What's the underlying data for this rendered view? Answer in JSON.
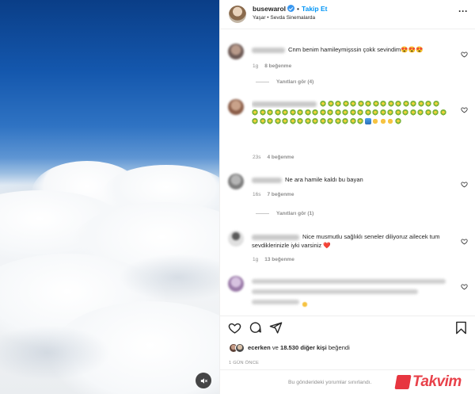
{
  "post": {
    "username": "busewarol",
    "follow_label": "Takip Et",
    "location_line": "Yaşar • Sevda Sinemalarda"
  },
  "comments": [
    {
      "text": "Cnm benim hamileymişssin çokk sevindim",
      "emoji": "😍😍😍",
      "time": "1g",
      "likes": "8 beğenme",
      "replies_label": "Yanıtları gör (4)"
    },
    {
      "text": "",
      "time": "23s",
      "likes": "4 beğenme",
      "emoji_rows": [
        [
          "g",
          "g",
          "g",
          "g",
          "g",
          "g",
          "g",
          "g",
          "g",
          "g",
          "g",
          "g",
          "g",
          "g",
          "g",
          "g"
        ],
        [
          "g",
          "g",
          "g",
          "g",
          "g",
          "g",
          "g",
          "g",
          "g",
          "g",
          "g",
          "g",
          "g",
          "g",
          "g",
          "g",
          "g",
          "g",
          "g",
          "g",
          "g",
          "g",
          "g",
          "g",
          "g",
          "g"
        ],
        [
          "g",
          "g",
          "g",
          "g",
          "g",
          "g",
          "g",
          "g",
          "g",
          "g",
          "g",
          "g",
          "g",
          "g",
          "g",
          "b",
          "y",
          "y",
          "y",
          "g"
        ]
      ]
    },
    {
      "text": "Ne ara hamile kaldı bu bayan",
      "time": "16s",
      "likes": "7 beğenme",
      "replies_label": "Yanıtları gör (1)"
    },
    {
      "text": "Nice musmutlu sağlıklı seneler diliyoruz ailecek tum sevdiklerinizle iyki varsiniz",
      "emoji": "❤️",
      "time": "1g",
      "likes": "13 beğenme"
    }
  ],
  "likes_summary": {
    "user": "ecerken",
    "ve_label": "ve",
    "count": "18.530 diğer kişi",
    "suffix": "beğendi"
  },
  "date": "1 GÜN ÖNCE",
  "footer_text": "Bu gönderideki yorumlar sınırlandı.",
  "watermark": "Takvim",
  "icons": {
    "like": "heart-icon",
    "comment": "comment-icon",
    "share": "paper-plane-icon",
    "save": "bookmark-icon",
    "audio": "speaker-muted-icon",
    "more": "more-options-icon"
  },
  "colors": {
    "accent": "#0095f6",
    "heart": "#ed4956",
    "muted": "#8e8e8e",
    "watermark": "#e4202b"
  }
}
